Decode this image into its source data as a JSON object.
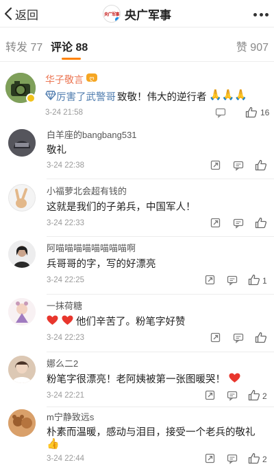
{
  "header": {
    "back_label": "返回",
    "title": "央广军事",
    "logo_text": "央广军事"
  },
  "tabs": {
    "repost": "转发 77",
    "comment": "评论 88",
    "like": "赞 907"
  },
  "comments": [
    {
      "user": "华子敬言",
      "text_link": "厉害了武警哥",
      "text_rest": "致敬！伟大的逆行者",
      "time": "3-24 21:58",
      "likes": "16"
    },
    {
      "user": "白羊座的bangbang531",
      "text": "敬礼",
      "time": "3-24 22:38",
      "likes": ""
    },
    {
      "user": "小福萝北会超有钱的",
      "text": "这就是我们的子弟兵，中国军人！",
      "time": "3-24 22:33",
      "likes": ""
    },
    {
      "user": "阿喵喵喵喵喵喵喵喵啊",
      "text": "兵哥哥的字，写的好漂亮",
      "time": "3-24 22:25",
      "likes": "1"
    },
    {
      "user": "一抹荷糖",
      "text": "他们辛苦了。粉笔字好赞",
      "time": "3-24 22:23",
      "likes": ""
    },
    {
      "user": "娜么二2",
      "text": "粉笔字很漂亮！老阿姨被第一张图暖哭！",
      "time": "3-24 22:21",
      "likes": "2"
    },
    {
      "user": "m宁静致远s",
      "text": "朴素而温暖，感动与泪目，接受一个老兵的敬礼",
      "time": "3-24 22:44",
      "likes": "2"
    }
  ],
  "colors": {
    "accent": "#ff8200",
    "link": "#507daf",
    "vip_name": "#eb7350",
    "heart": "#e8362d"
  }
}
